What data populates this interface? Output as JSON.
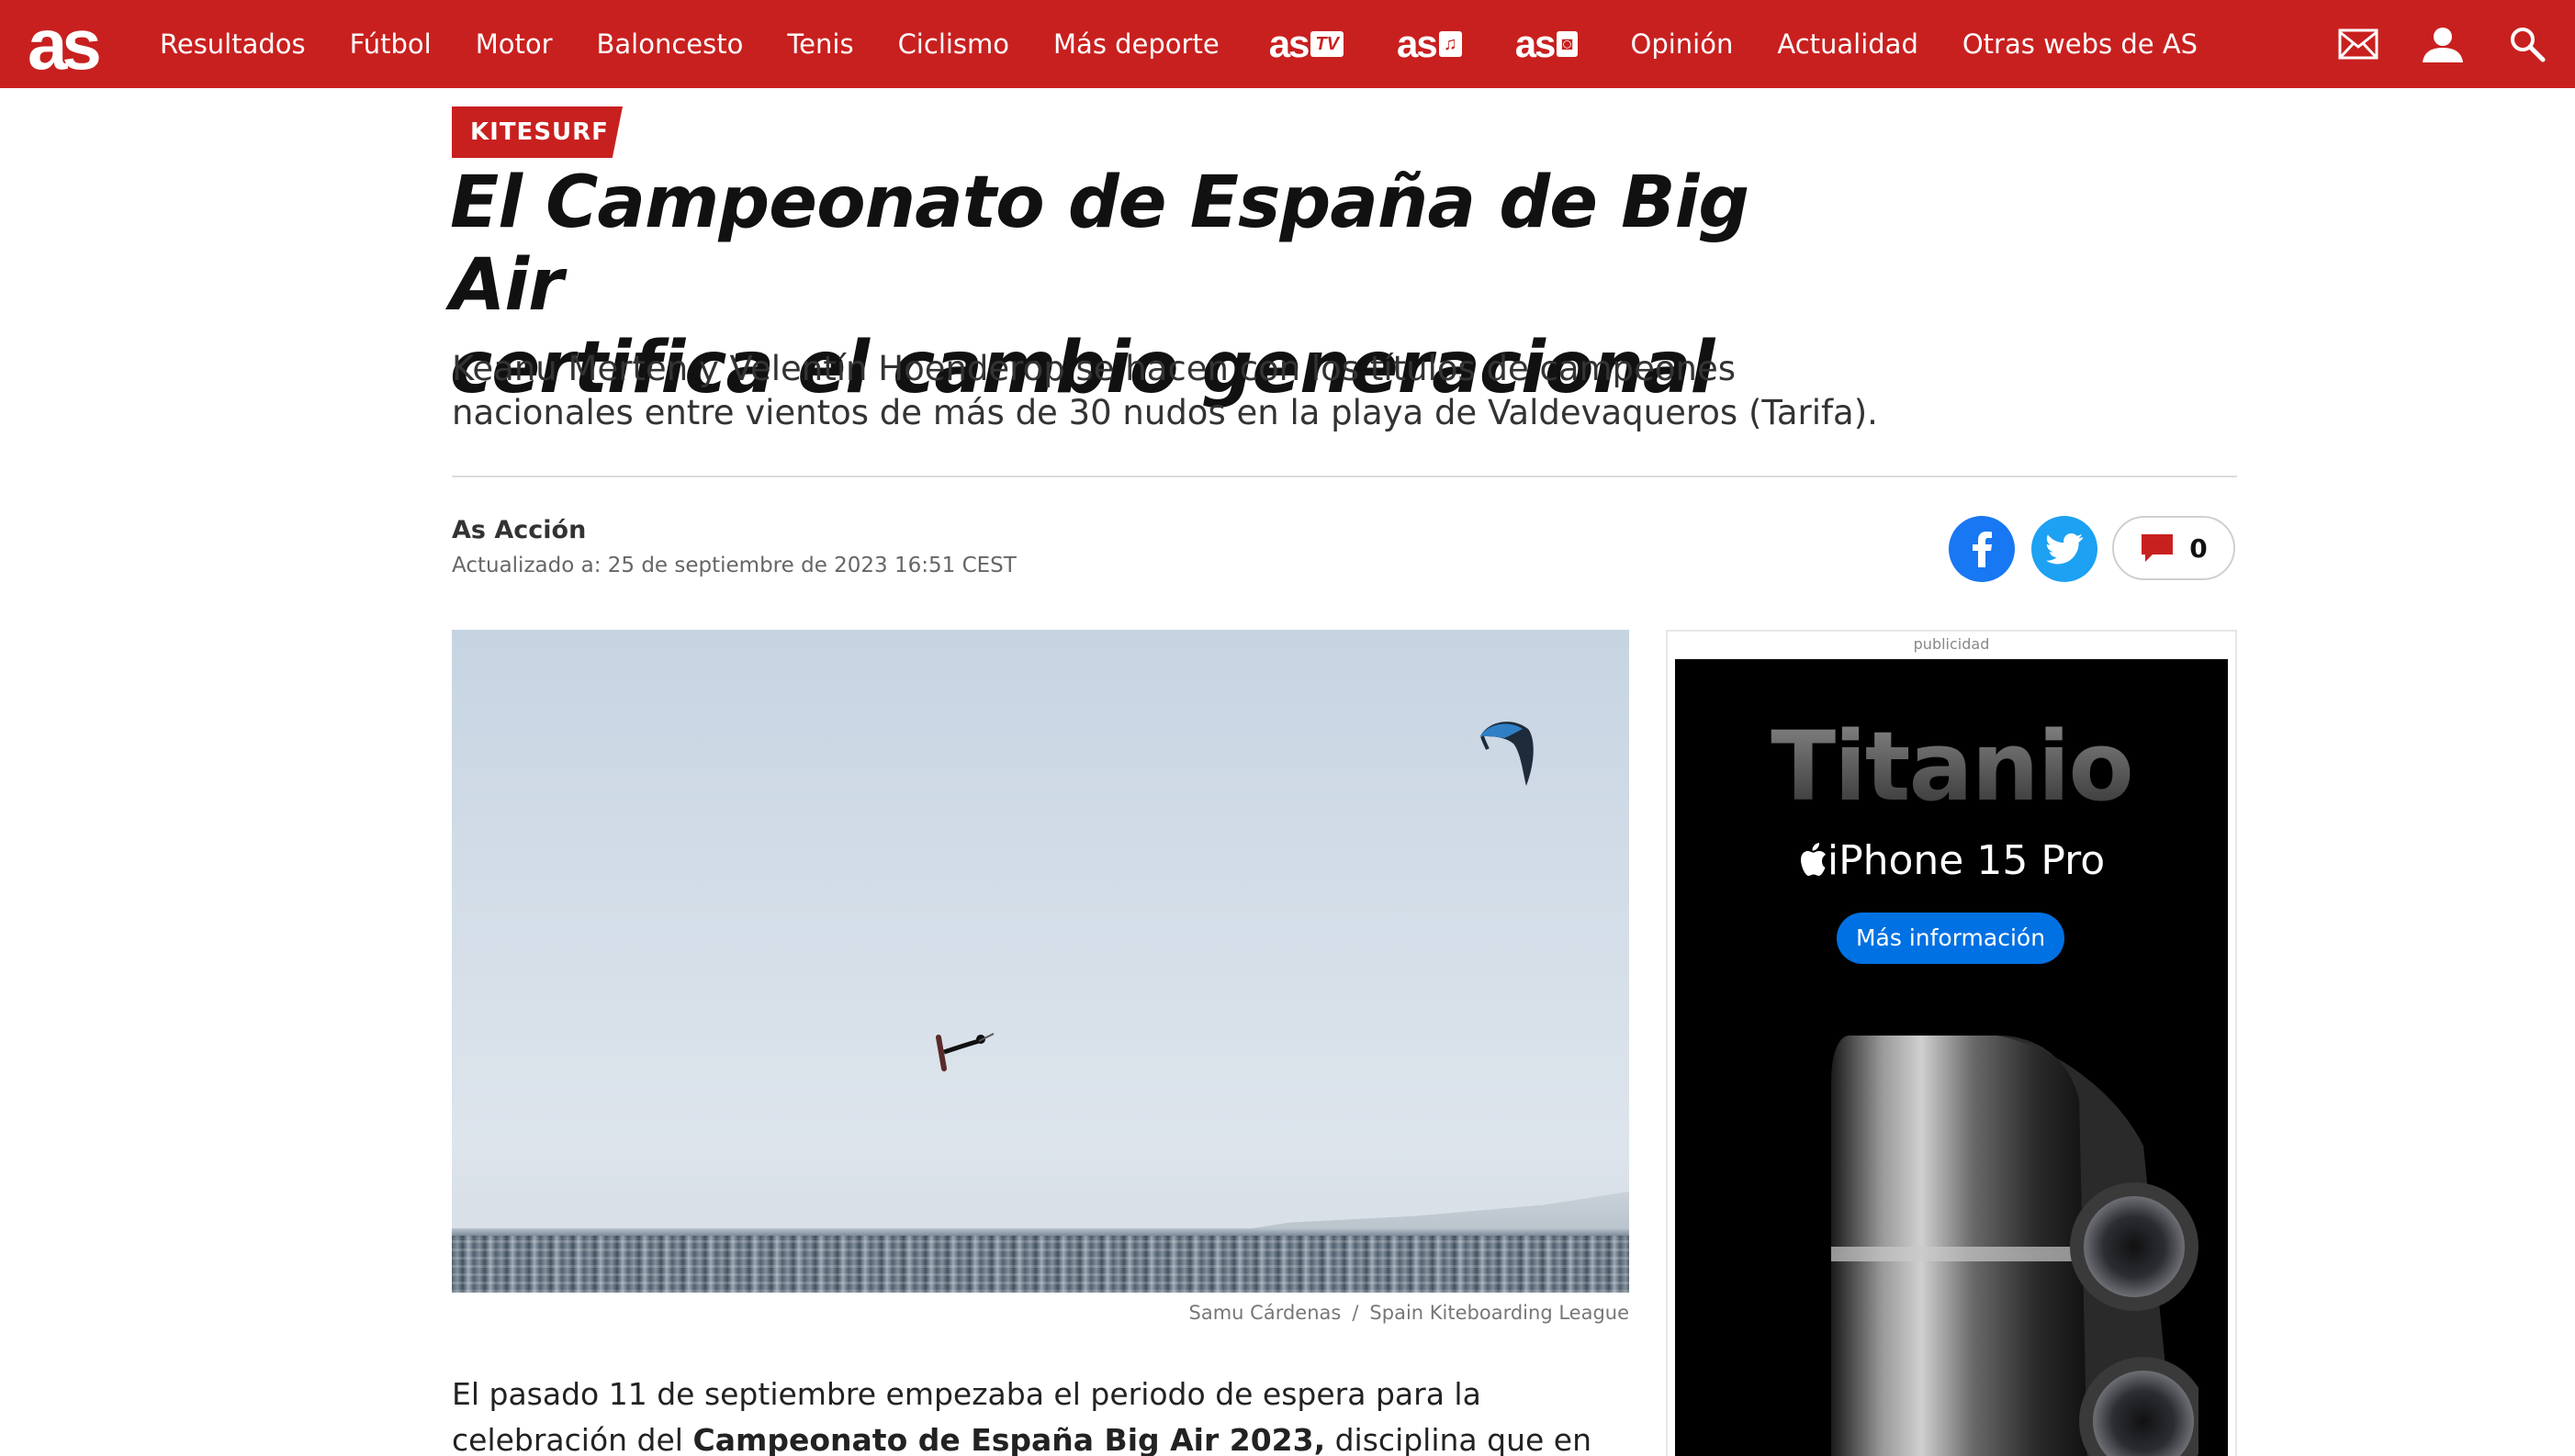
{
  "nav": {
    "logo": "as",
    "items": [
      "Resultados",
      "Fútbol",
      "Motor",
      "Baloncesto",
      "Tenis",
      "Ciclismo",
      "Más deporte"
    ],
    "brands": [
      {
        "text": "as",
        "badge": "TV"
      },
      {
        "text": "as",
        "badge": "♫"
      },
      {
        "text": "as",
        "badge": "◙"
      }
    ],
    "items_right": [
      "Opinión",
      "Actualidad",
      "Otras webs de AS"
    ],
    "icons": [
      "mail-icon",
      "user-icon",
      "search-icon"
    ]
  },
  "article": {
    "section": "KITESURF",
    "headline_line1": "El Campeonato de España de Big Air",
    "headline_line2": "certifica el cambio generacional",
    "subhead": "Keanu Merten y Velentín Hoenderop se hacen con los títulos de campeones nacionales entre vientos de más de 30 nudos en la playa de Valdevaqueros (Tarifa).",
    "author": "As Acción",
    "updated": "Actualizado a: 25 de septiembre de 2023 16:51 CEST",
    "comments_count": "0",
    "photo_credit": "Samu Cárdenas",
    "photo_source": "Spain Kiteboarding League",
    "body_part1": "El pasado 11 de septiembre empezaba el periodo de espera para la celebración del ",
    "body_bold": "Campeonato de España Big Air 2023,",
    "body_part2": " disciplina que en los últimos años se abre"
  },
  "ad": {
    "label": "publicidad",
    "title": "Titanio",
    "product": "iPhone 15 Pro",
    "cta": "Más información"
  },
  "colors": {
    "brand_red": "#c8201f",
    "facebook": "#1877f2",
    "twitter": "#1da1f2"
  }
}
